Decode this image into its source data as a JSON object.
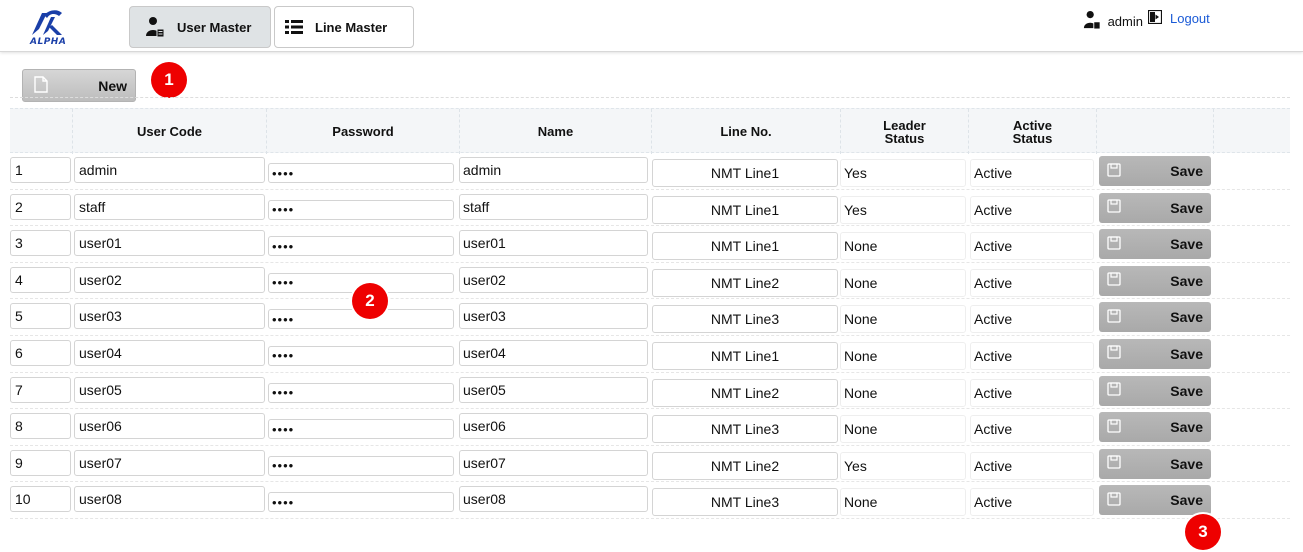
{
  "header": {
    "logo_text": "ALPHA",
    "tabs": [
      {
        "label": "User Master",
        "active": true
      },
      {
        "label": "Line Master",
        "active": false
      }
    ],
    "user": "admin",
    "logout_label": "Logout"
  },
  "toolbar": {
    "new_label": "New"
  },
  "annotations": [
    "1",
    "2",
    "3"
  ],
  "columns": [
    "User Code",
    "Password",
    "Name",
    "Line No.",
    "Leader Status",
    "Active Status"
  ],
  "rows": [
    {
      "no": "1",
      "code": "admin",
      "password": "••••",
      "name": "admin",
      "line": "NMT Line1",
      "leader": "Yes",
      "active": "Active",
      "save": "Save"
    },
    {
      "no": "2",
      "code": "staff",
      "password": "••••",
      "name": "staff",
      "line": "NMT Line1",
      "leader": "Yes",
      "active": "Active",
      "save": "Save"
    },
    {
      "no": "3",
      "code": "user01",
      "password": "••••",
      "name": "user01",
      "line": "NMT Line1",
      "leader": "None",
      "active": "Active",
      "save": "Save"
    },
    {
      "no": "4",
      "code": "user02",
      "password": "••••",
      "name": "user02",
      "line": "NMT Line2",
      "leader": "None",
      "active": "Active",
      "save": "Save"
    },
    {
      "no": "5",
      "code": "user03",
      "password": "••••",
      "name": "user03",
      "line": "NMT Line3",
      "leader": "None",
      "active": "Active",
      "save": "Save"
    },
    {
      "no": "6",
      "code": "user04",
      "password": "••••",
      "name": "user04",
      "line": "NMT Line1",
      "leader": "None",
      "active": "Active",
      "save": "Save"
    },
    {
      "no": "7",
      "code": "user05",
      "password": "••••",
      "name": "user05",
      "line": "NMT Line2",
      "leader": "None",
      "active": "Active",
      "save": "Save"
    },
    {
      "no": "8",
      "code": "user06",
      "password": "••••",
      "name": "user06",
      "line": "NMT Line3",
      "leader": "None",
      "active": "Active",
      "save": "Save"
    },
    {
      "no": "9",
      "code": "user07",
      "password": "••••",
      "name": "user07",
      "line": "NMT Line2",
      "leader": "Yes",
      "active": "Active",
      "save": "Save"
    },
    {
      "no": "10",
      "code": "user08",
      "password": "••••",
      "name": "user08",
      "line": "NMT Line3",
      "leader": "None",
      "active": "Active",
      "save": "Save"
    }
  ],
  "colors": {
    "accent": "#1a3fa8",
    "link": "#1a5ad6",
    "badge": "#ee0000"
  }
}
